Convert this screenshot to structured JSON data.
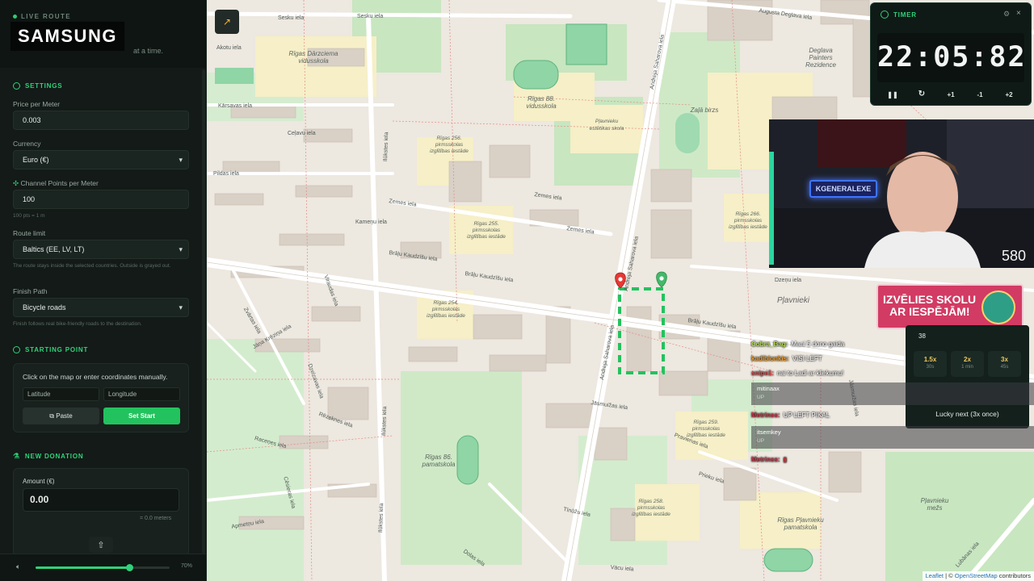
{
  "sidebar": {
    "live_label": "LIVE ROUTE",
    "brand": "SAMSUNG",
    "tagline": "at a time.",
    "settings": {
      "title": "SETTINGS",
      "price_label": "Price per Meter",
      "price_value": "0.003",
      "currency_label": "Currency",
      "currency_value": "Euro (€)",
      "points_label": "Channel Points per Meter",
      "points_value": "100",
      "points_hint": "100 pts = 1 m",
      "route_limit_label": "Route limit",
      "route_limit_value": "Baltics (EE, LV, LT)",
      "route_limit_hint": "The route stays inside the selected countries. Outside is grayed out.",
      "finish_label": "Finish Path",
      "finish_value": "Bicycle roads",
      "finish_hint": "Finish follows real bike-friendly roads to the destination."
    },
    "starting_point": {
      "title": "STARTING POINT",
      "instruction": "Click on the map or enter coordinates manually.",
      "lat_placeholder": "Latitude",
      "lng_placeholder": "Longitude",
      "paste_label": "Paste",
      "start_label": "Set Start"
    },
    "donation": {
      "title": "NEW DONATION",
      "amount_label": "Amount (€)",
      "amount_value": "0.00",
      "meters_text": "= 0.0 meters"
    },
    "volume": {
      "percent": 70,
      "label": "70%"
    }
  },
  "map": {
    "attribution_leaflet": "Leaflet",
    "attribution_sep": " | © ",
    "attribution_osm": "OpenStreetMap",
    "attribution_tail": " contributors",
    "streets": {
      "sesku1": "Sesku iela",
      "sesku2": "Sesku iela",
      "augusta": "Augusta Deglava iela",
      "akotu": "Akotu iela",
      "karsavas": "Kārsavas iela",
      "cesvainesa": "Ceļavu iela",
      "pildas": "Pildas iela",
      "zemes1": "Zemes iela",
      "zemes2": "Zemes iela",
      "kamenu": "Kameņu iela",
      "kaudzisu1": "Brāļu Kaudzīšu iela",
      "kaudzisu2": "Brāļu Kaudzīšu iela",
      "kaudzisu3": "Brāļu Kaudzīšu iela",
      "saharova1": "Andreja Saharova iela",
      "saharova2": "Andreja Saharova iela",
      "saharova3": "Andreja Saharova iela",
      "dzenu": "Dzeņu iela",
      "jasmuizas": "Jāsmuižas iela",
      "prieku": "Prieku iela",
      "tinuzu": "Tīnūžu iela",
      "vacas": "Vācu iela",
      "ilukstes1": "Ilūkstes iela",
      "ilukstes2": "Ilūkstes iela",
      "ilukstes3": "Ilūkstes iela",
      "virsnas": "Viraudas iela",
      "zvartas": "Zvārtas iela",
      "janakrez": "Jāņa Krēziņa iela",
      "rezeknes": "Rēzeknes iela",
      "dzelzs": "Dzelzavas iela",
      "ruds": "Raceņes iela",
      "apmetnu": "Apmetņu iela",
      "jasmuizas2": "Jāsmuižas iela",
      "lubanas": "Lubānas iela",
      "pravienas": "Pravienas iela",
      "dolas": "Dolas iela",
      "ciedras": "Cēsieras iela"
    },
    "places": {
      "darzciema": "Rīgas Dārzciema vidusskola",
      "r88": "Rīgas 88. vidusskola",
      "plaviekn": "Pļavnieku estētikas skola",
      "deglava": "Deglava Painters Rezidence",
      "zalabirz": "Zaļā birzs",
      "pii256": "Rīgas 256. pirmsskolas izglītības iestāde",
      "pii255": "Rīgas 255. pirmsskolas izglītības iestāde",
      "pii254": "Rīgas 254. pirmsskolas izglītības iestāde",
      "pii266": "Rīgas 266. pirmsskolas izglītības iestāde",
      "pii259": "Rīgas 259. pirmsskolas izglītības iestāde",
      "pii258": "Rīgas 258. pirmsskolas izglītības iestāde",
      "pam86": "Rīgas 86. pamatskola",
      "pleviekupam": "Rīgas Pļavnieku pamatskola",
      "plavnieki": "Pļavnieki",
      "plavmezs": "Pļavnieku mežs"
    }
  },
  "timer": {
    "title": "TIMER",
    "display": "22:05:82",
    "controls": [
      "+1",
      "-1",
      "+2"
    ]
  },
  "webcam": {
    "sign": "KGENERALEXE",
    "viewer_count": "580"
  },
  "promo": {
    "line1": "IZVĒLIES SKOLU",
    "line2": "AR IESPĒJĀM!"
  },
  "multiplier": {
    "value": "38",
    "buttons": [
      {
        "mult": "1.5x",
        "dur": "30s"
      },
      {
        "mult": "2x",
        "dur": "1 min"
      },
      {
        "mult": "3x",
        "dur": "45s"
      }
    ],
    "lucky": "Lucky next (3x once)"
  },
  "chat": {
    "l1_user": "Cobra_Bag:",
    "l1_text": "Mani 5 dono gaida",
    "l2_user": "kadiblonkis:",
    "l2_text": "VISI LEFT",
    "l3_user": "snipe1:",
    "l3_text": "nai to Ladi ar kliekumu!",
    "r1_name": "mitinaax",
    "r1_text": "UP",
    "l4_user": "Metrinss:",
    "l4_text": "UP LEFT PIKAL",
    "r2_name": "itsemkey",
    "r2_text": "UP",
    "l5_user": "Metrinss:",
    "l5_text": "▮"
  },
  "colors": {
    "accent": "#2fd27a",
    "route": "#22c35e",
    "promo": "#d23b63",
    "marker_start": "#e53935",
    "marker_end": "#43b96a"
  }
}
